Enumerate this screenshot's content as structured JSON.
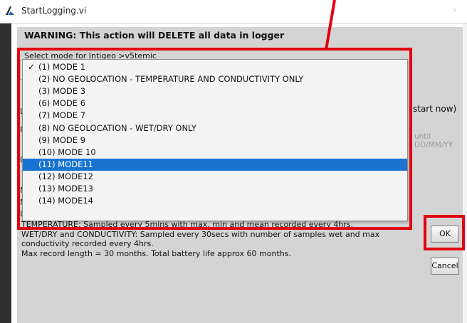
{
  "window": {
    "title": "StartLogging.vi"
  },
  "warning": "WARNING: This action will DELETE all data in logger",
  "mode_select": {
    "label": "Select mode for Intigeo >v5temic",
    "selected_index": 8,
    "options": [
      {
        "label": "(1) MODE 1",
        "checked": true
      },
      {
        "label": "(2) NO GEOLOCATION - TEMPERATURE AND CONDUCTIVITY ONLY",
        "checked": false
      },
      {
        "label": "(3) MODE 3",
        "checked": false
      },
      {
        "label": "(6) MODE 6",
        "checked": false
      },
      {
        "label": "(7) MODE 7",
        "checked": false
      },
      {
        "label": "(8) NO GEOLOCATION - WET/DRY ONLY",
        "checked": false
      },
      {
        "label": "(9) MODE 9",
        "checked": false
      },
      {
        "label": "(10) MODE 10",
        "checked": false
      },
      {
        "label": "(11) MODE11",
        "checked": false
      },
      {
        "label": "(12) MODE12",
        "checked": false
      },
      {
        "label": "(13) MODE13",
        "checked": false
      },
      {
        "label": "(14) MODE14",
        "checked": false
      }
    ]
  },
  "partially_hidden": {
    "start_now": "start now)",
    "until_hint_1": "until",
    "until_hint_2": "DD/MM/YY"
  },
  "description": {
    "lines": [
      "TEMPERATURE: Sampled every 5mins with max, min and mean recorded every 4hrs.",
      "WET/DRY and CONDUCTIVITY: Sampled every 30secs with number of samples wet and max",
      "conductivity recorded every 4hrs.",
      "Max record length = 30 months. Total battery life approx 60 months."
    ]
  },
  "buttons": {
    "ok": "OK",
    "cancel": "Cancel"
  },
  "colors": {
    "highlight": "#e3000f",
    "selection": "#1874d0",
    "panel": "#d4d4d4"
  }
}
